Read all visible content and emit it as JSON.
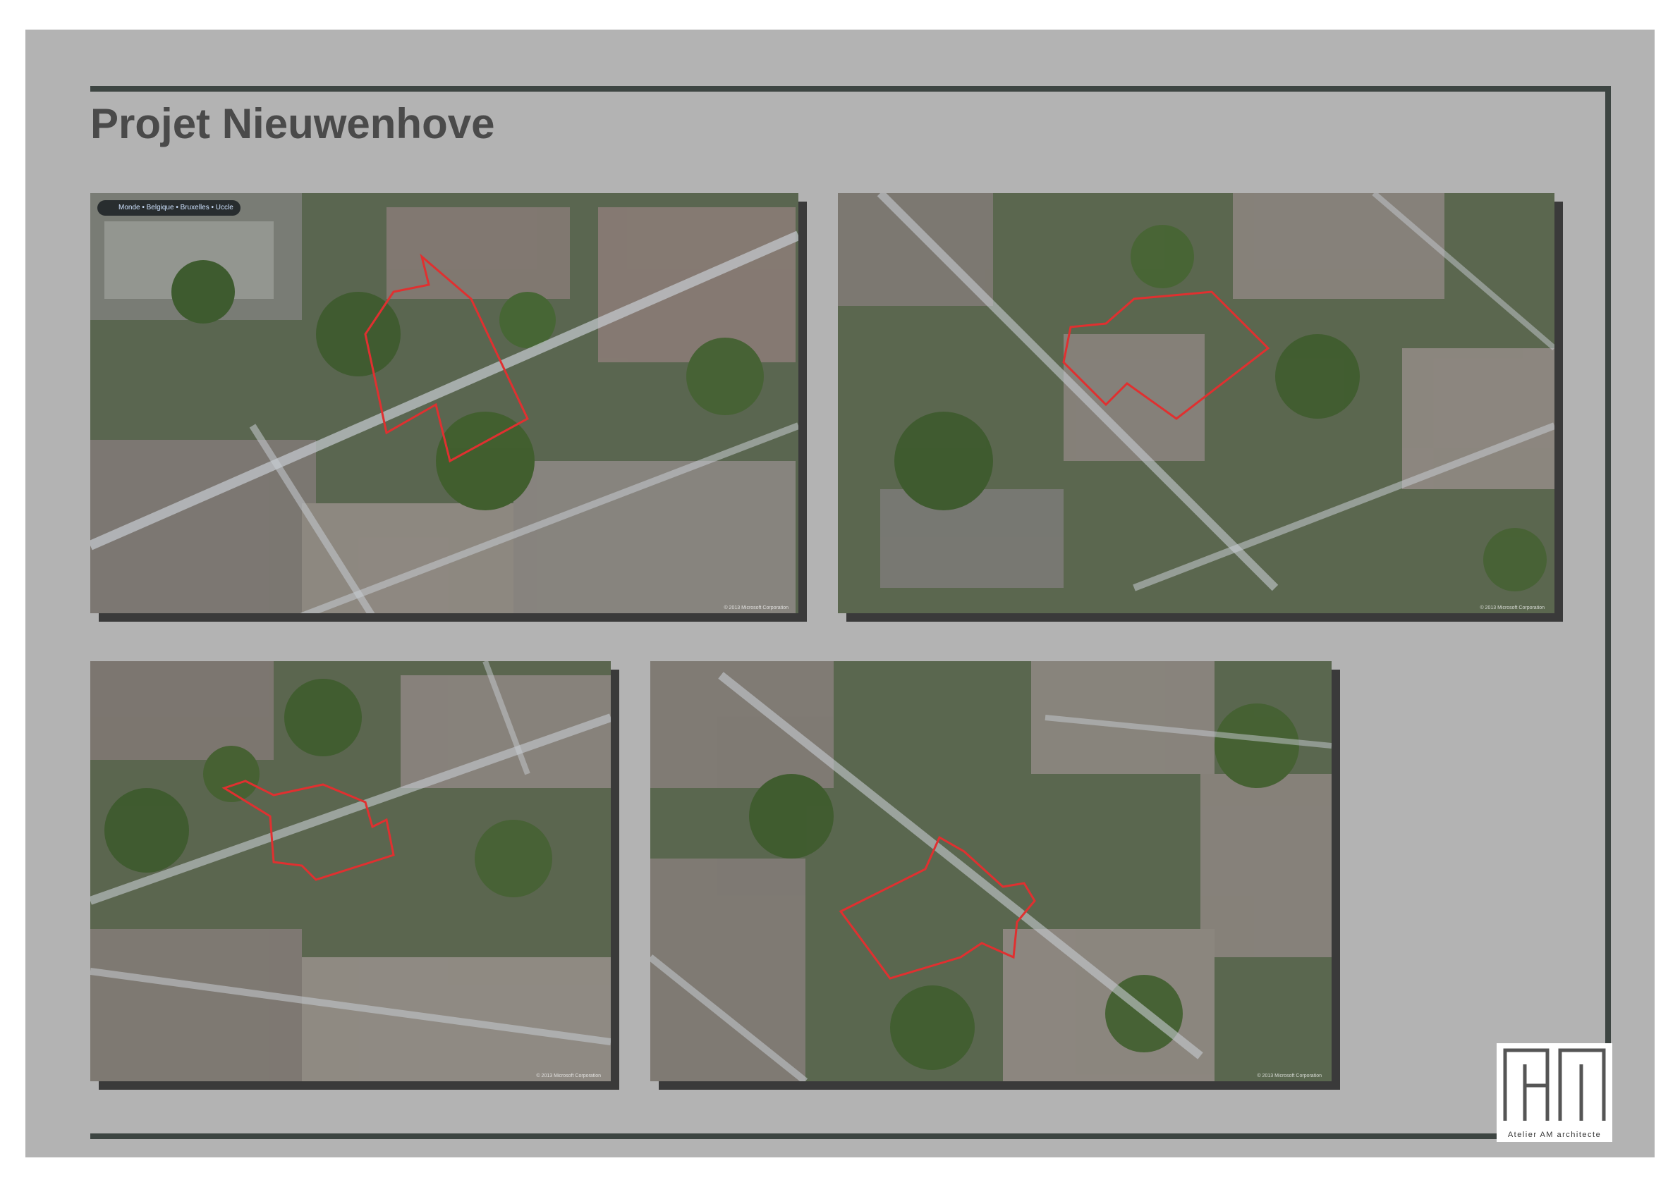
{
  "title": "Projet Nieuwenhove",
  "breadcrumb": "Monde • Belgique • Bruxelles • Uccle",
  "copyright": "© 2013 Microsoft Corporation",
  "logo": {
    "caption": "Atelier AM architecte"
  },
  "colors": {
    "sheet": "#b3b3b3",
    "rule": "#3d4542",
    "title": "#4a4a4a",
    "outline": "#e03030"
  },
  "photos": [
    {
      "name": "aerial-view-north"
    },
    {
      "name": "aerial-view-east"
    },
    {
      "name": "aerial-view-south"
    },
    {
      "name": "aerial-view-west"
    }
  ]
}
